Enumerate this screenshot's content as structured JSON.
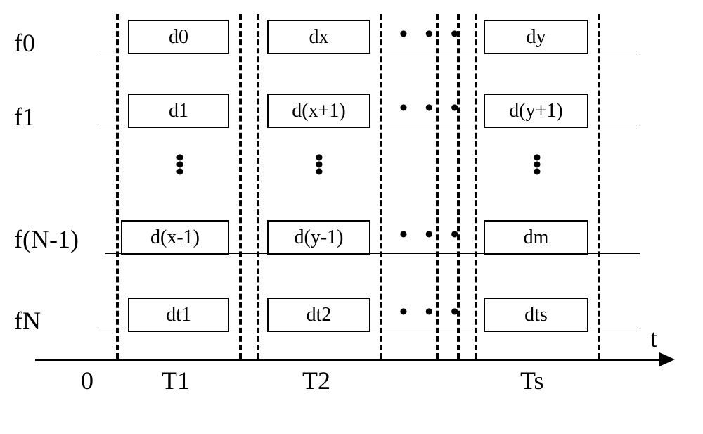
{
  "rows": {
    "f0": {
      "label": "f0",
      "cells": [
        "d0",
        "dx",
        "dy"
      ]
    },
    "f1": {
      "label": "f1",
      "cells": [
        "d1",
        "d(x+1)",
        "d(y+1)"
      ]
    },
    "fNm1": {
      "label": "f(N-1)",
      "cells": [
        "d(x-1)",
        "d(y-1)",
        "dm"
      ]
    },
    "fN": {
      "label": "fN",
      "cells": [
        "dt1",
        "dt2",
        "dts"
      ]
    }
  },
  "axis": {
    "origin": "0",
    "ticks": [
      "T1",
      "T2",
      "Ts"
    ],
    "var": "t"
  },
  "ellipsis": "• • •"
}
